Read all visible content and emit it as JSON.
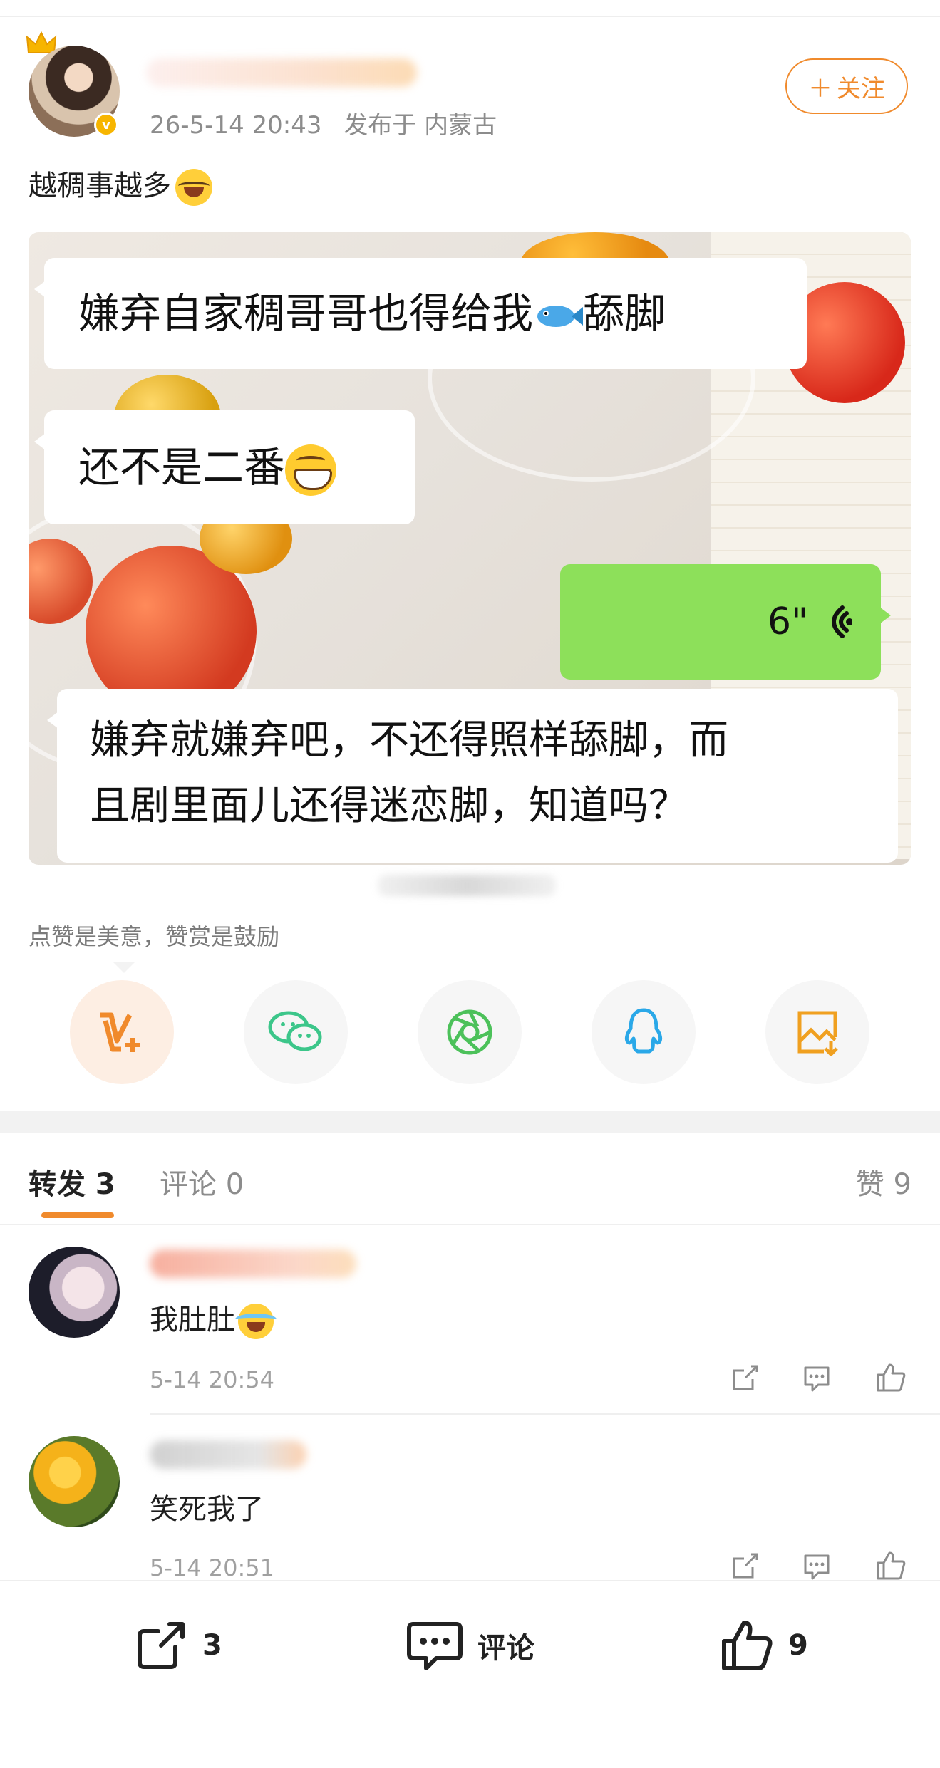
{
  "post": {
    "meta_time": "26-5-14 20:43",
    "meta_location": "发布于 内蒙古",
    "follow_label": "关注",
    "text": "越稠事越多"
  },
  "image_chat": {
    "bubble1": "嫌弃自家稠哥哥也得给我",
    "bubble1_suffix": "舔脚",
    "bubble2": "还不是二番",
    "voice_duration": "6\"",
    "bubble3_line1": "嫌弃就嫌弃吧，不还得照样舔脚，而",
    "bubble3_line2": "且剧里面儿还得迷恋脚，知道吗？"
  },
  "reward": {
    "tip": "点赞是美意，赞赏是鼓励",
    "buttons": [
      "reward-icon",
      "wechat-icon",
      "moments-icon",
      "qq-icon",
      "save-image-icon"
    ]
  },
  "tabs": {
    "repost": "转发 3",
    "comments": "评论 0",
    "likes": "赞 9"
  },
  "comments": [
    {
      "text": "我肚肚",
      "time": "5-14 20:54"
    },
    {
      "text": "笑死我了",
      "time": "5-14 20:51"
    }
  ],
  "bottom_bar": {
    "repost_count": "3",
    "comment_label": "评论",
    "like_count": "9"
  },
  "colors": {
    "accent": "#f08a2c",
    "voice_bubble": "#8de05a",
    "wechat": "#3cc68a",
    "qq": "#2aa8e8"
  }
}
